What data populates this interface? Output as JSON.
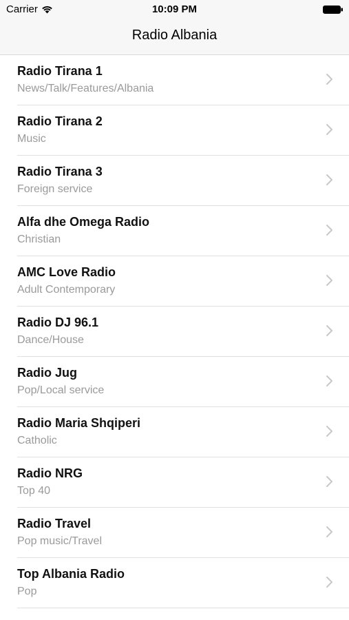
{
  "status_bar": {
    "carrier": "Carrier",
    "time": "10:09 PM",
    "wifi_icon": "wifi-icon",
    "battery_icon": "battery-icon"
  },
  "navbar": {
    "title": "Radio Albania"
  },
  "colors": {
    "navbar_bg": "#f7f7f7",
    "title_text": "#111111",
    "subtitle_text": "#9a9a9a",
    "separator": "#e0e0e0",
    "chevron": "#c7c7cc"
  },
  "stations": [
    {
      "name": "Radio Tirana 1",
      "genre": "News/Talk/Features/Albania"
    },
    {
      "name": "Radio Tirana 2",
      "genre": "Music"
    },
    {
      "name": "Radio Tirana 3",
      "genre": "Foreign service"
    },
    {
      "name": "Alfa dhe Omega Radio",
      "genre": "Christian"
    },
    {
      "name": "AMC Love Radio",
      "genre": "Adult Contemporary"
    },
    {
      "name": "Radio DJ 96.1",
      "genre": "Dance/House"
    },
    {
      "name": "Radio Jug",
      "genre": "Pop/Local service"
    },
    {
      "name": "Radio Maria Shqiperi",
      "genre": "Catholic"
    },
    {
      "name": "Radio NRG",
      "genre": "Top 40"
    },
    {
      "name": "Radio Travel",
      "genre": "Pop music/Travel"
    },
    {
      "name": "Top Albania Radio",
      "genre": "Pop"
    }
  ]
}
